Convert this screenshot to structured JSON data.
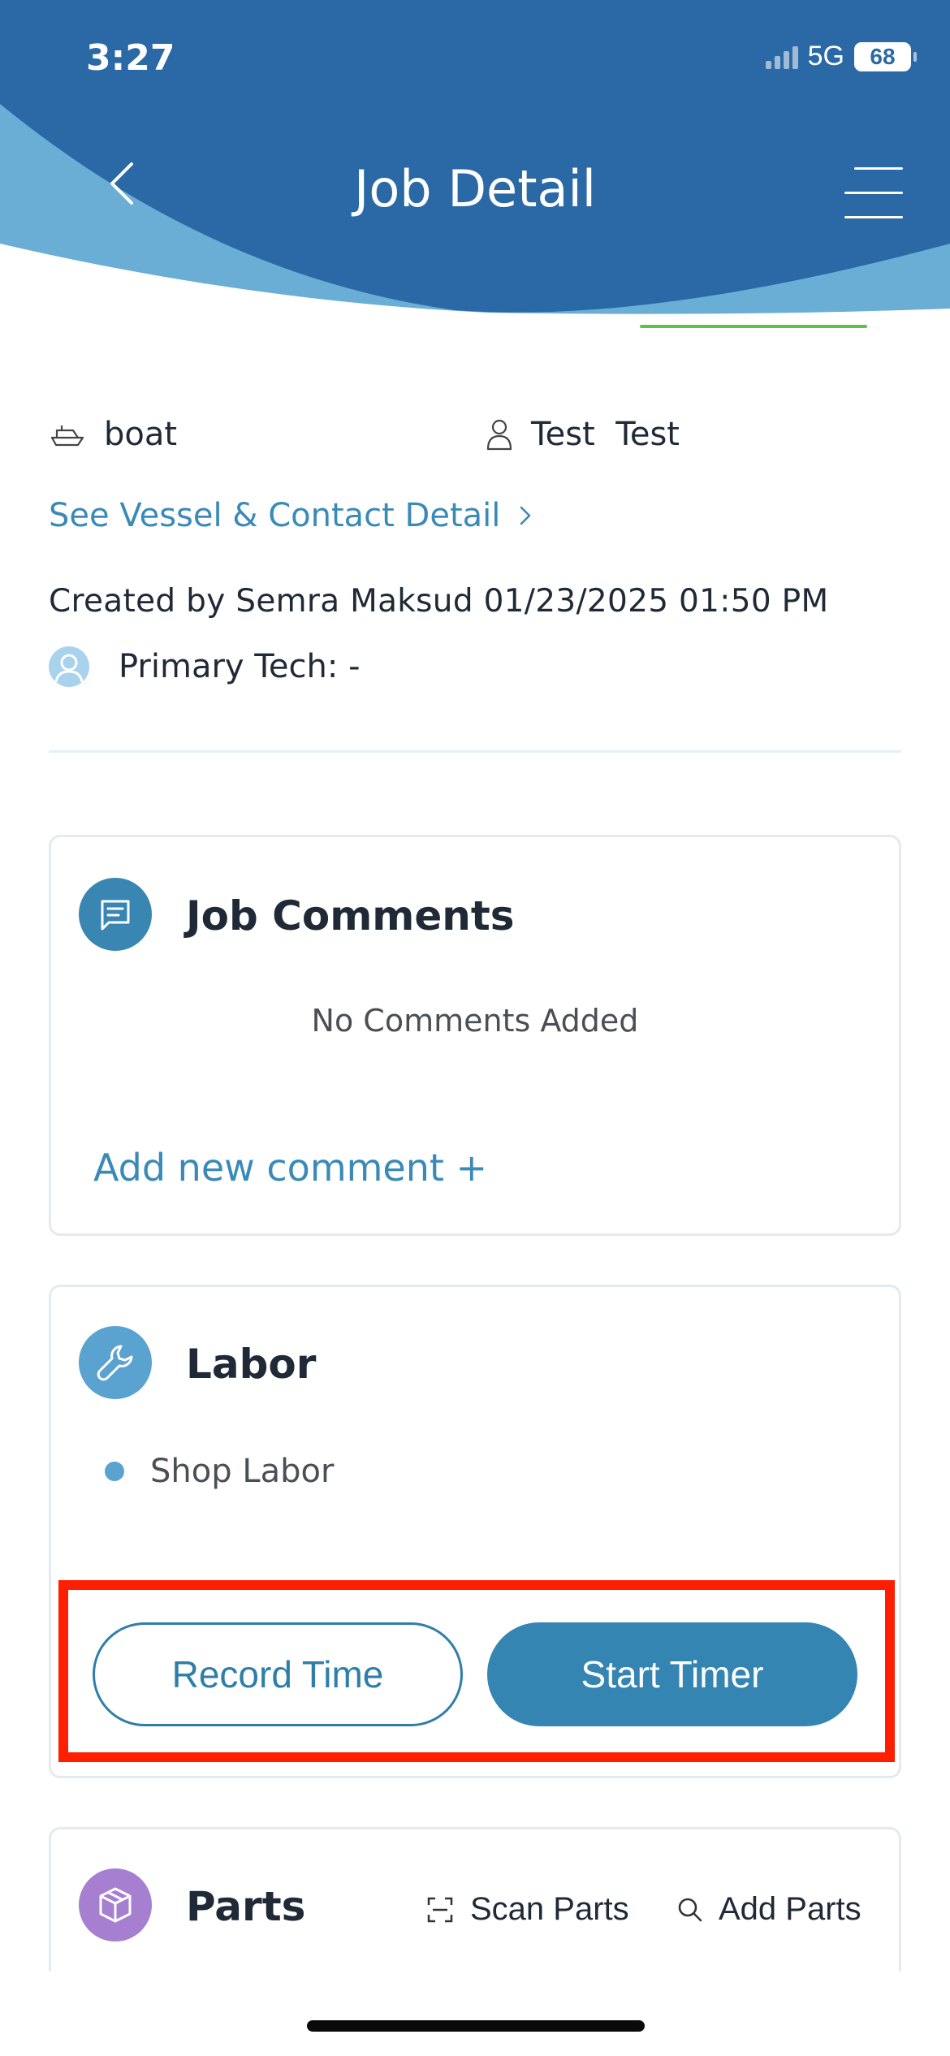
{
  "status_bar": {
    "time": "3:27",
    "network": "5G",
    "battery": "68"
  },
  "header": {
    "title": "Job Detail",
    "back_icon": "chevron-left-icon",
    "menu_icon": "hamburger-menu-icon",
    "colors": {
      "primary": "#2a69a6",
      "wave_light": "#6aaed6"
    }
  },
  "job_info": {
    "vessel_name": "boat",
    "contact_name": "Test  Test",
    "see_detail_link": "See Vessel & Contact Detail",
    "created_by": "Created by Semra Maksud 01/23/2025 01:50 PM",
    "primary_tech": "Primary Tech: -"
  },
  "comments_card": {
    "title": "Job Comments",
    "empty_text": "No Comments Added",
    "add_link": "Add new comment +"
  },
  "labor_card": {
    "title": "Labor",
    "items": [
      "Shop Labor"
    ],
    "record_button": "Record Time",
    "start_button": "Start Timer"
  },
  "parts_card": {
    "title": "Parts",
    "scan_button": "Scan Parts",
    "add_button": "Add Parts"
  }
}
